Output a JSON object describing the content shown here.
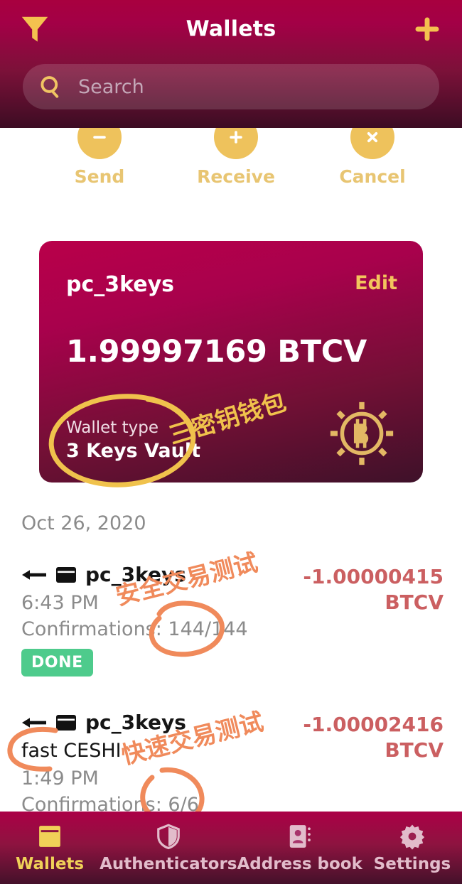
{
  "header": {
    "title": "Wallets",
    "filter_icon": "filter-funnel-icon",
    "add_icon": "plus-icon",
    "search": {
      "icon": "search-icon",
      "placeholder": "Search",
      "value": ""
    }
  },
  "actions": [
    {
      "label": "Send",
      "icon": "minus-icon"
    },
    {
      "label": "Receive",
      "icon": "plus-icon"
    },
    {
      "label": "Cancel",
      "icon": "close-x-icon"
    }
  ],
  "wallet_card": {
    "name": "pc_3keys",
    "edit_label": "Edit",
    "balance": "1.99997169 BTCV",
    "type_label": "Wallet type",
    "type_value": "3 Keys Vault",
    "logo_icon": "bitcoin-vault-logo-icon",
    "gradient_from": "#b9004a",
    "gradient_to": "#3e1129"
  },
  "transactions": {
    "date_header": "Oct 26, 2020",
    "items": [
      {
        "direction_icon": "arrow-left-icon",
        "wallet_icon": "wallet-card-icon",
        "wallet_name": "pc_3keys",
        "memo": "",
        "time": "6:43 PM",
        "confirmations": "Confirmations: 144/144",
        "status_badge": "DONE",
        "amount": "-1.00000415",
        "currency": "BTCV"
      },
      {
        "direction_icon": "arrow-left-icon",
        "wallet_icon": "wallet-card-icon",
        "wallet_name": "pc_3keys",
        "memo": "fast CESHI",
        "time": "1:49 PM",
        "confirmations": "Confirmations: 6/6",
        "status_badge": "",
        "amount": "-1.00002416",
        "currency": "BTCV"
      }
    ]
  },
  "annotations": {
    "card_note": "三密钥钱包",
    "tx1_note": "安全交易测试",
    "tx2_note": "快速交易测试",
    "highlight_color_gold": "#f0c24c",
    "highlight_color_orange": "#f08a5b"
  },
  "tabbar": {
    "items": [
      {
        "label": "Wallets",
        "icon": "wallet-icon",
        "active": true
      },
      {
        "label": "Authenticators",
        "icon": "shield-icon",
        "active": false
      },
      {
        "label": "Address book",
        "icon": "address-book-icon",
        "active": false
      },
      {
        "label": "Settings",
        "icon": "gear-icon",
        "active": false
      }
    ]
  }
}
